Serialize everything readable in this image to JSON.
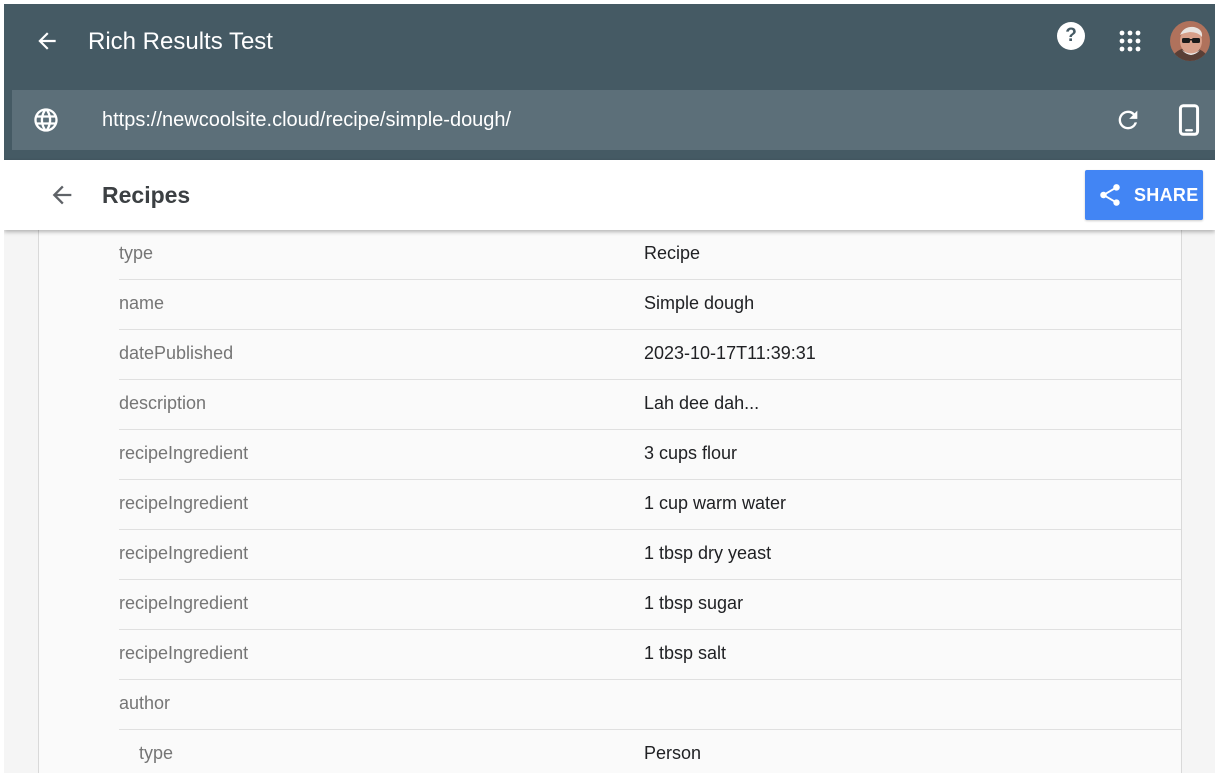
{
  "app": {
    "title": "Rich Results Test",
    "help_glyph": "?"
  },
  "urlbar": {
    "url": "https://newcoolsite.cloud/recipe/simple-dough/"
  },
  "section": {
    "title": "Recipes",
    "share_label": "SHARE"
  },
  "colors": {
    "appbar": "#455a64",
    "urlbar": "#5c6f79",
    "share_button": "#4285f4"
  },
  "icons": {
    "back": "arrow-left-icon",
    "help": "help-circle-icon",
    "apps": "apps-grid-icon",
    "globe": "globe-icon",
    "refresh": "refresh-icon",
    "device": "smartphone-icon",
    "share": "share-icon"
  },
  "properties": [
    {
      "key": "type",
      "value": "Recipe"
    },
    {
      "key": "name",
      "value": "Simple dough"
    },
    {
      "key": "datePublished",
      "value": "2023-10-17T11:39:31"
    },
    {
      "key": "description",
      "value": "Lah dee dah..."
    },
    {
      "key": "recipeIngredient",
      "value": "3 cups flour"
    },
    {
      "key": "recipeIngredient",
      "value": "1 cup warm water"
    },
    {
      "key": "recipeIngredient",
      "value": "1 tbsp dry yeast"
    },
    {
      "key": "recipeIngredient",
      "value": "1 tbsp sugar"
    },
    {
      "key": "recipeIngredient",
      "value": "1 tbsp salt"
    },
    {
      "key": "author",
      "value": ""
    },
    {
      "key": "type",
      "value": "Person"
    }
  ]
}
